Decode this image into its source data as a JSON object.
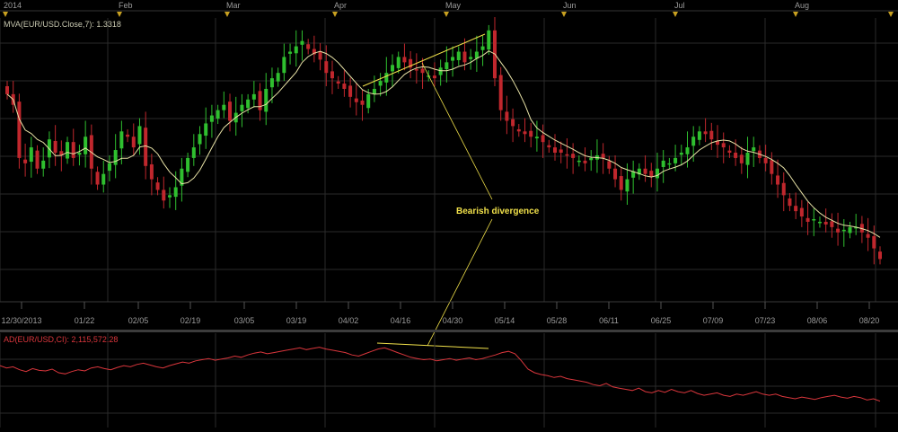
{
  "colors": {
    "background": "#000000",
    "grid": "#2a2a2a",
    "up_candle": "#2fbf2f",
    "down_candle": "#c0272d",
    "mva_line": "#e8e2a6",
    "ad_line": "#d9363c",
    "annotation": "#f0e04a",
    "marker": "#c8a020",
    "text": "#9a9a9a"
  },
  "timeline": {
    "months": [
      "2014",
      "Feb",
      "Mar",
      "Apr",
      "May",
      "Jun",
      "Jul",
      "Aug"
    ]
  },
  "price_panel": {
    "indicator_label": "MVA(EUR/USD.Close,7): 1.3318"
  },
  "ad_panel": {
    "indicator_label": "AD(EUR/USD,CI): 2,115,572.28"
  },
  "annotation": {
    "text": "Bearish divergence"
  },
  "chart_data": [
    {
      "type": "candlestick",
      "title": "",
      "x_tick_labels": [
        "12/30/2013",
        "01/22",
        "02/05",
        "02/19",
        "03/05",
        "03/19",
        "04/02",
        "04/16",
        "04/30",
        "05/14",
        "05/28",
        "06/11",
        "06/25",
        "07/09",
        "07/23",
        "08/06",
        "08/20"
      ],
      "indicator": "MVA(EUR/USD.Close,7)",
      "indicator_last_value": 1.3318,
      "close_series_description": "Daily EUR/USD price levels in relative units (0 = low of period, 100 = high of period)",
      "close": [
        72,
        68,
        48,
        46,
        52,
        44,
        47,
        55,
        50,
        49,
        54,
        48,
        50,
        56,
        44,
        38,
        42,
        46,
        51,
        58,
        56,
        52,
        60,
        45,
        40,
        36,
        32,
        34,
        37,
        44,
        48,
        52,
        57,
        61,
        64,
        66,
        68,
        62,
        65,
        68,
        70,
        72,
        66,
        74,
        78,
        80,
        86,
        88,
        90,
        92,
        89,
        87,
        85,
        80,
        78,
        76,
        74,
        71,
        69,
        68,
        72,
        74,
        77,
        80,
        83,
        86,
        84,
        82,
        81,
        80,
        79,
        78,
        82,
        84,
        86,
        88,
        84,
        86,
        88,
        90,
        96,
        78,
        66,
        62,
        60,
        58,
        57,
        56,
        56,
        54,
        52,
        50,
        50,
        49,
        48,
        47,
        46,
        48,
        49,
        48,
        44,
        40,
        36,
        40,
        43,
        44,
        42,
        41,
        44,
        47,
        46,
        48,
        50,
        52,
        56,
        58,
        57,
        55,
        53,
        52,
        50,
        48,
        46,
        50,
        52,
        48,
        46,
        42,
        38,
        34,
        30,
        28,
        26,
        24,
        25,
        24,
        23,
        22,
        20,
        21,
        22,
        22,
        20,
        18,
        14,
        10
      ]
    },
    {
      "type": "line",
      "title": "",
      "indicator": "AD(EUR/USD,CI)",
      "last_value": "2,115,572.28",
      "series": [
        {
          "name": "AD(EUR/USD,CI)",
          "values": [
            62,
            58,
            60,
            55,
            52,
            57,
            54,
            53,
            56,
            50,
            48,
            52,
            55,
            53,
            58,
            60,
            57,
            55,
            59,
            62,
            60,
            64,
            66,
            63,
            60,
            58,
            62,
            65,
            68,
            66,
            70,
            72,
            74,
            71,
            73,
            75,
            78,
            76,
            80,
            83,
            85,
            82,
            84,
            86,
            88,
            90,
            92,
            89,
            91,
            93,
            90,
            88,
            86,
            84,
            80,
            78,
            82,
            86,
            90,
            92,
            88,
            84,
            80,
            76,
            74,
            72,
            73,
            70,
            72,
            74,
            71,
            73,
            75,
            72,
            74,
            77,
            80,
            84,
            86,
            82,
            70,
            56,
            50,
            47,
            45,
            42,
            44,
            40,
            38,
            36,
            34,
            30,
            28,
            32,
            26,
            24,
            22,
            20,
            24,
            18,
            16,
            20,
            17,
            22,
            18,
            16,
            20,
            15,
            12,
            14,
            16,
            12,
            10,
            14,
            12,
            15,
            18,
            14,
            12,
            14,
            10,
            8,
            6,
            9,
            7,
            5,
            8,
            10,
            12,
            9,
            7,
            10,
            8,
            4,
            6,
            2
          ]
        }
      ]
    }
  ]
}
